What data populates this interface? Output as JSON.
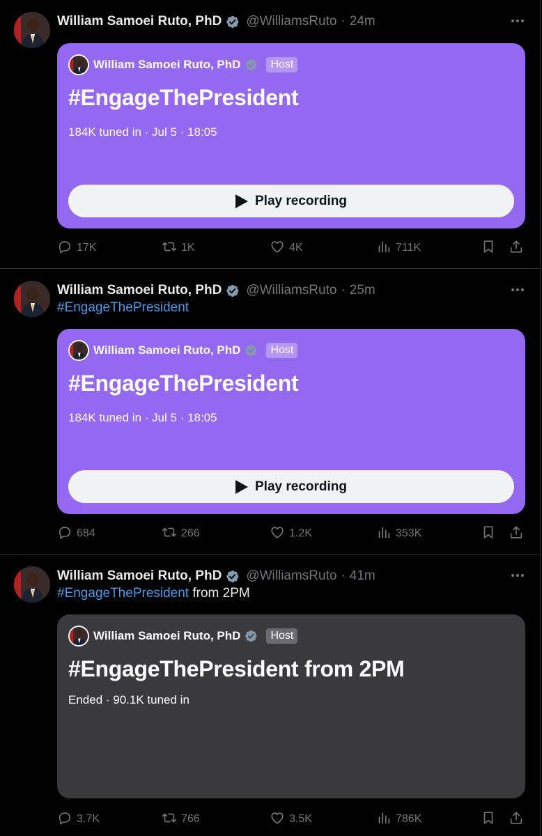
{
  "tweets": [
    {
      "author": {
        "name": "William Samoei Ruto, PhD",
        "handle": "@WilliamsRuto",
        "time": "24m"
      },
      "text": {
        "hashtag": "",
        "rest": ""
      },
      "space": {
        "state": "live",
        "host_name": "William Samoei Ruto, PhD",
        "host_badge": "Host",
        "title": "#EngageThePresident",
        "meta": "184K tuned in · Jul 5 · 18:05",
        "button_label": "Play recording"
      },
      "stats": {
        "replies": "17K",
        "reposts": "1K",
        "likes": "4K",
        "views": "711K"
      }
    },
    {
      "author": {
        "name": "William Samoei Ruto, PhD",
        "handle": "@WilliamsRuto",
        "time": "25m"
      },
      "text": {
        "hashtag": "#EngageThePresident",
        "rest": ""
      },
      "space": {
        "state": "live",
        "host_name": "William Samoei Ruto, PhD",
        "host_badge": "Host",
        "title": "#EngageThePresident",
        "meta": "184K tuned in · Jul 5 · 18:05",
        "button_label": "Play recording"
      },
      "stats": {
        "replies": "684",
        "reposts": "266",
        "likes": "1.2K",
        "views": "353K"
      }
    },
    {
      "author": {
        "name": "William Samoei Ruto, PhD",
        "handle": "@WilliamsRuto",
        "time": "41m"
      },
      "text": {
        "hashtag": "#EngageThePresident",
        "rest": " from 2PM"
      },
      "space": {
        "state": "ended",
        "host_name": "William Samoei Ruto, PhD",
        "host_badge": "Host",
        "title": "#EngageThePresident from 2PM",
        "meta": "Ended · 90.1K tuned in",
        "button_label": ""
      },
      "stats": {
        "replies": "3.7K",
        "reposts": "766",
        "likes": "3.5K",
        "views": "786K"
      }
    }
  ],
  "icons": {
    "verified": "verified-badge-icon",
    "more": "more-horizontal-icon",
    "reply": "reply-bubble-icon",
    "repost": "repost-arrows-icon",
    "like": "heart-icon",
    "views": "bar-chart-icon",
    "bookmark": "bookmark-icon",
    "share": "share-upload-icon",
    "play": "play-icon"
  },
  "colors": {
    "background": "#000000",
    "live_card": "#9468f0",
    "ended_card": "#3a393e",
    "link": "#4d9ae8",
    "muted": "#71767b",
    "verified_badge": "#829aab"
  }
}
